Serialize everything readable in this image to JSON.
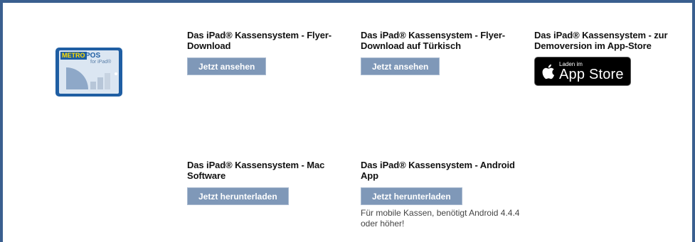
{
  "logo": {
    "brand": "METRO",
    "product": "POS",
    "sub": "for iPad®"
  },
  "items": [
    {
      "title": "Das iPad® Kassensystem - Flyer-Download",
      "button": "Jetzt ansehen"
    },
    {
      "title": "Das iPad® Kassensystem - Flyer-Download auf Türkisch",
      "button": "Jetzt ansehen"
    },
    {
      "title": "Das iPad® Kassensystem - zur Demoversion im App-Store",
      "badge_small": "Laden im",
      "badge_big": "App Store"
    },
    {
      "title": "Das iPad® Kassensystem - Mac Software",
      "button": "Jetzt herunterladen"
    },
    {
      "title": "Das iPad® Kassensystem - Android App",
      "button": "Jetzt herunterladen",
      "note": "Für mobile Kassen, benötigt Android 4.4.4 oder höher!"
    }
  ],
  "colors": {
    "frame": "#3a5f8f",
    "button": "#7f98b8",
    "logo_blue": "#1f5ea3"
  }
}
